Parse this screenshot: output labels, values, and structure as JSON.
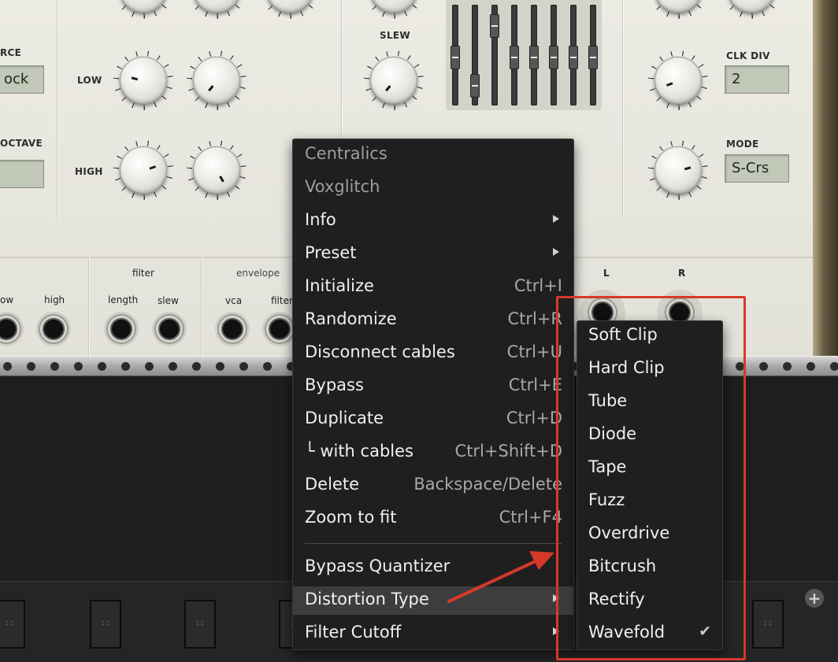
{
  "module": {
    "label_source": "RCE",
    "display_source": "ock",
    "label_octave": "OCTAVE",
    "label_low": "LOW",
    "label_high": "HIGH",
    "label_slew": "SLEW",
    "label_clk_div": "CLK DIV",
    "display_clk_div": "2",
    "label_mode": "MODE",
    "display_mode": "S-Crs",
    "section_filter": "filter",
    "section_envelope": "envelope",
    "jack_low": "ow",
    "jack_high": "high",
    "jack_length": "length",
    "jack_slew": "slew",
    "jack_vca": "vca",
    "jack_filter": "filter",
    "out_left": "L",
    "out_right": "R"
  },
  "context_menu": {
    "header_brand": "Centralics",
    "header_plugin": "Voxglitch",
    "items": [
      {
        "label": "Info",
        "shortcut": ""
      },
      {
        "label": "Preset",
        "shortcut": ""
      },
      {
        "label": "Initialize",
        "shortcut": "Ctrl+I"
      },
      {
        "label": "Randomize",
        "shortcut": "Ctrl+R"
      },
      {
        "label": "Disconnect cables",
        "shortcut": "Ctrl+U"
      },
      {
        "label": "Bypass",
        "shortcut": "Ctrl+E"
      },
      {
        "label": "Duplicate",
        "shortcut": "Ctrl+D"
      },
      {
        "label": "└ with cables",
        "shortcut": "Ctrl+Shift+D"
      },
      {
        "label": "Delete",
        "shortcut": "Backspace/Delete"
      },
      {
        "label": "Zoom to fit",
        "shortcut": "Ctrl+F4"
      }
    ],
    "extra_items": [
      {
        "label": "Bypass Quantizer"
      },
      {
        "label": "Distortion Type"
      },
      {
        "label": "Filter Cutoff"
      }
    ]
  },
  "submenu": {
    "items": [
      {
        "label": "Soft Clip"
      },
      {
        "label": "Hard Clip"
      },
      {
        "label": "Tube"
      },
      {
        "label": "Diode"
      },
      {
        "label": "Tape"
      },
      {
        "label": "Fuzz"
      },
      {
        "label": "Overdrive"
      },
      {
        "label": "Bitcrush"
      },
      {
        "label": "Rectify"
      },
      {
        "label": "Wavefold"
      }
    ],
    "checkmark": "✔"
  },
  "rack": {
    "plus_label": "+",
    "port_dots": "::"
  },
  "colors": {
    "highlight": "#d6392a",
    "menu_bg": "#1f1f1f",
    "panel_bg": "#ecebe3"
  }
}
